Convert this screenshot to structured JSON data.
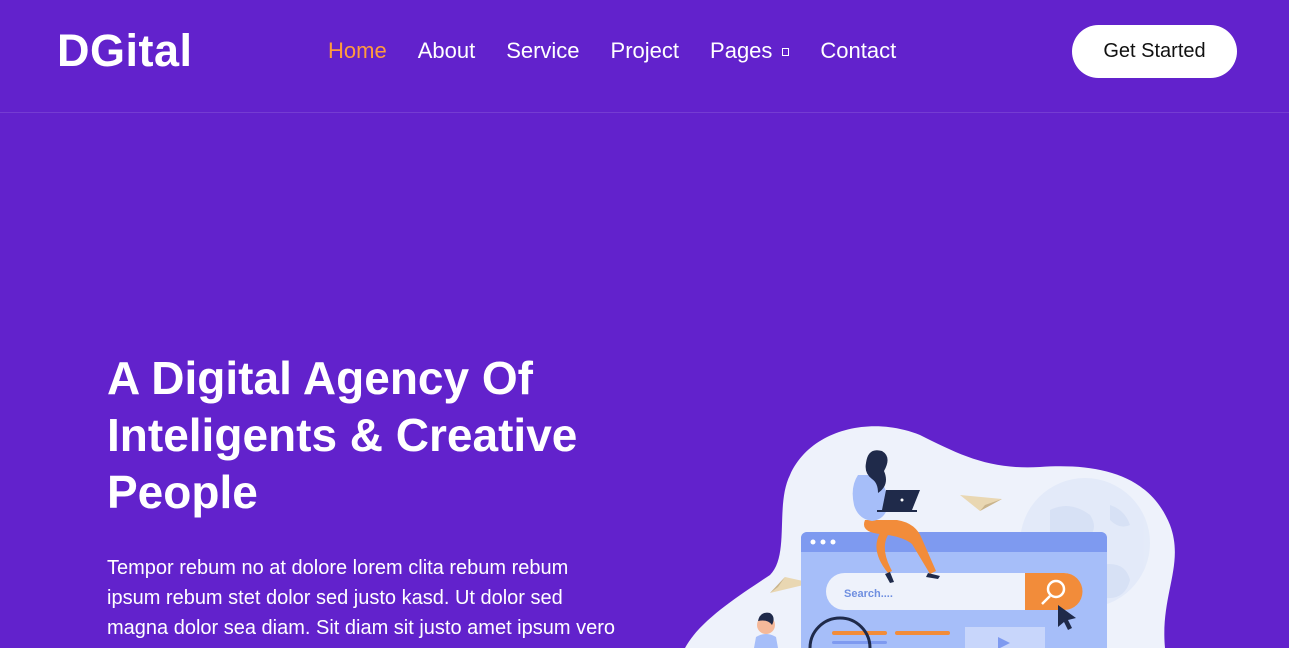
{
  "brand": {
    "name": "DGital"
  },
  "nav": {
    "items": [
      {
        "label": "Home",
        "active": true
      },
      {
        "label": "About"
      },
      {
        "label": "Service"
      },
      {
        "label": "Project"
      },
      {
        "label": "Pages",
        "has_dropdown": true
      },
      {
        "label": "Contact"
      }
    ]
  },
  "cta": {
    "label": "Get Started"
  },
  "hero": {
    "title_lines": [
      "A Digital Agency Of",
      "Inteligents & Creative",
      "People"
    ],
    "text_lines": [
      "Tempor rebum no at dolore lorem clita rebum rebum",
      "ipsum rebum stet dolor sed justo kasd. Ut dolor sed",
      "magna dolor sea diam. Sit diam sit justo amet ipsum vero"
    ]
  },
  "illustration": {
    "search_placeholder": "Search...."
  },
  "colors": {
    "background": "#6222CC",
    "accent": "#FF9B3D",
    "text": "#FFFFFF"
  }
}
